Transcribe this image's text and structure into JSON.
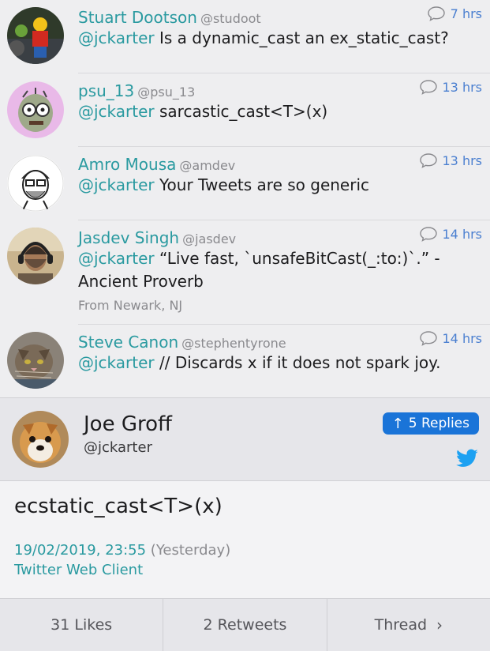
{
  "replies": [
    {
      "name": "Stuart Dootson",
      "handle": "@studoot",
      "mention": "@jckarter",
      "text": " Is a dynamic_cast an ex_static_cast?",
      "time": "7 hrs",
      "avatar": "lego-figure"
    },
    {
      "name": "psu_13",
      "handle": "@psu_13",
      "mention": "@jckarter",
      "text": " sarcastic_cast<T>(x)",
      "time": "13 hrs",
      "avatar": "zombie"
    },
    {
      "name": "Amro Mousa",
      "handle": "@amdev",
      "mention": "@jckarter",
      "text": " Your Tweets are so generic",
      "time": "13 hrs",
      "avatar": "sketch-portrait"
    },
    {
      "name": "Jasdev Singh",
      "handle": "@jasdev",
      "mention": "@jckarter",
      "text": " “Live fast, `unsafeBitCast(_:to:)`.” - Ancient Proverb",
      "time": "14 hrs",
      "location": "From Newark, NJ",
      "avatar": "person-headphones"
    },
    {
      "name": "Steve Canon",
      "handle": "@stephentyrone",
      "mention": "@jckarter",
      "text": " // Discards x if it does not spark joy.",
      "time": "14 hrs",
      "avatar": "cat"
    }
  ],
  "main": {
    "name": "Joe Groff",
    "handle": "@jckarter",
    "replies_label": "5 Replies",
    "text": "ecstatic_cast<T>(x)",
    "date": "19/02/2019, 23:55",
    "relative": "(Yesterday)",
    "client": "Twitter Web Client"
  },
  "footer": {
    "likes": "31 Likes",
    "retweets": "2 Retweets",
    "thread": "Thread"
  },
  "colors": {
    "accent": "#2a9aa0",
    "time": "#4a7fd0",
    "button": "#1a74d8",
    "twitter": "#1da1f2"
  }
}
